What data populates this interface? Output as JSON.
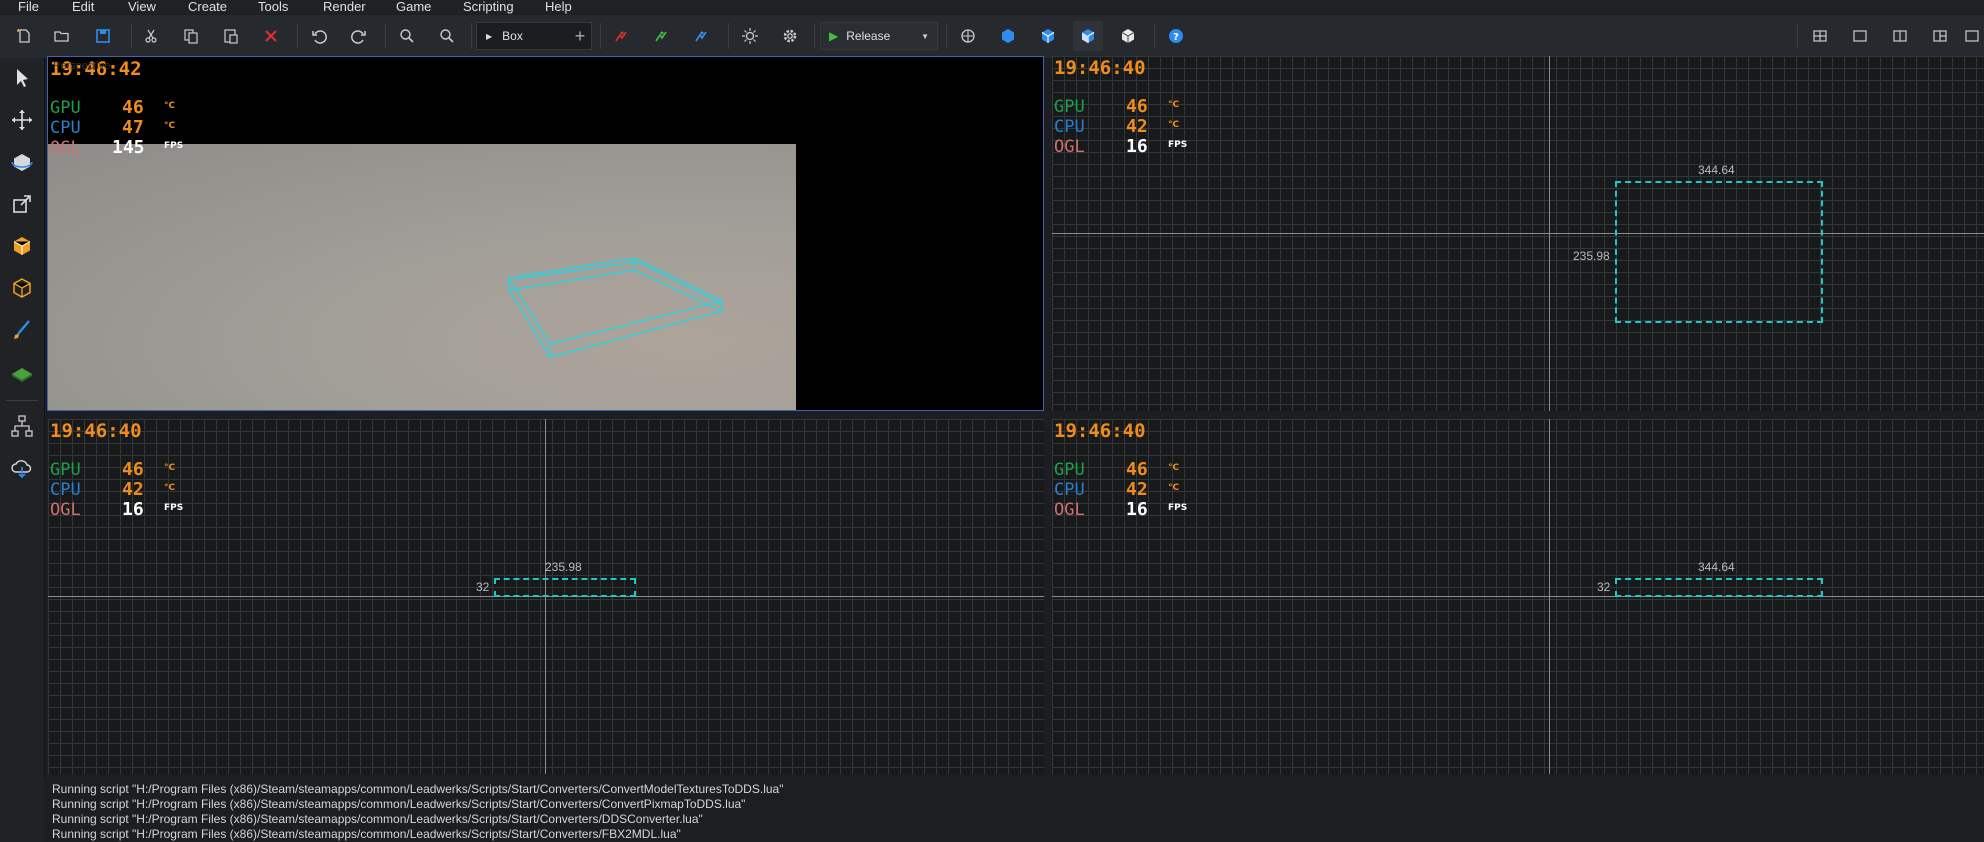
{
  "menu": [
    "File",
    "Edit",
    "View",
    "Create",
    "Tools",
    "Render",
    "Game",
    "Scripting",
    "Help"
  ],
  "toolbar": {
    "new_icon": "new-file-icon",
    "open_icon": "open-folder-icon",
    "save_icon": "save-icon",
    "cut_icon": "scissors-icon",
    "copy_icon": "copy-icon",
    "paste_icon": "paste-icon",
    "delete_icon": "delete-x-icon",
    "undo_icon": "undo-icon",
    "redo_icon": "redo-icon",
    "zoom_in_icon": "zoom-in-icon",
    "zoom_out_icon": "zoom-out-icon",
    "object_type": "Box",
    "build_config": "Release",
    "accent": "#2e8cf0"
  },
  "tools": [
    "select-icon",
    "move-icon",
    "rotate-icon",
    "scale-icon",
    "box-icon",
    "wireframe-box-icon",
    "paint-brush-icon",
    "terrain-icon",
    "hierarchy-icon",
    "cloud-download-icon"
  ],
  "viewports": {
    "perspective": {
      "clock": "19:46:42",
      "overlay_text": "Perspective",
      "gpu": "46",
      "cpu": "47",
      "ogl": "145"
    },
    "top": {
      "clock": "19:46:40",
      "gpu": "46",
      "cpu": "42",
      "ogl": "16",
      "dim_width": "344.64",
      "dim_depth": "235.98"
    },
    "front": {
      "clock": "19:46:40",
      "gpu": "46",
      "cpu": "42",
      "ogl": "16",
      "dim_width": "235.98",
      "dim_height": "32"
    },
    "side": {
      "clock": "19:46:40",
      "gpu": "46",
      "cpu": "42",
      "ogl": "16",
      "dim_width": "344.64",
      "dim_height": "32"
    }
  },
  "hud_labels": {
    "gpu": "GPU",
    "cpu": "CPU",
    "ogl": "OGL",
    "temp_unit": "°C",
    "fps_unit": "FPS",
    "color_gpu": "#1fa04a",
    "color_cpu": "#2a7fd0",
    "color_ogl": "#d07070",
    "color_value": "#f08c1c"
  },
  "console": [
    "Running script \"H:/Program Files (x86)/Steam/steamapps/common/Leadwerks/Scripts/Start/Converters/ConvertModelTexturesToDDS.lua\"",
    "Running script \"H:/Program Files (x86)/Steam/steamapps/common/Leadwerks/Scripts/Start/Converters/ConvertPixmapToDDS.lua\"",
    "Running script \"H:/Program Files (x86)/Steam/steamapps/common/Leadwerks/Scripts/Start/Converters/DDSConverter.lua\"",
    "Running script \"H:/Program Files (x86)/Steam/steamapps/common/Leadwerks/Scripts/Start/Converters/FBX2MDL.lua\""
  ]
}
